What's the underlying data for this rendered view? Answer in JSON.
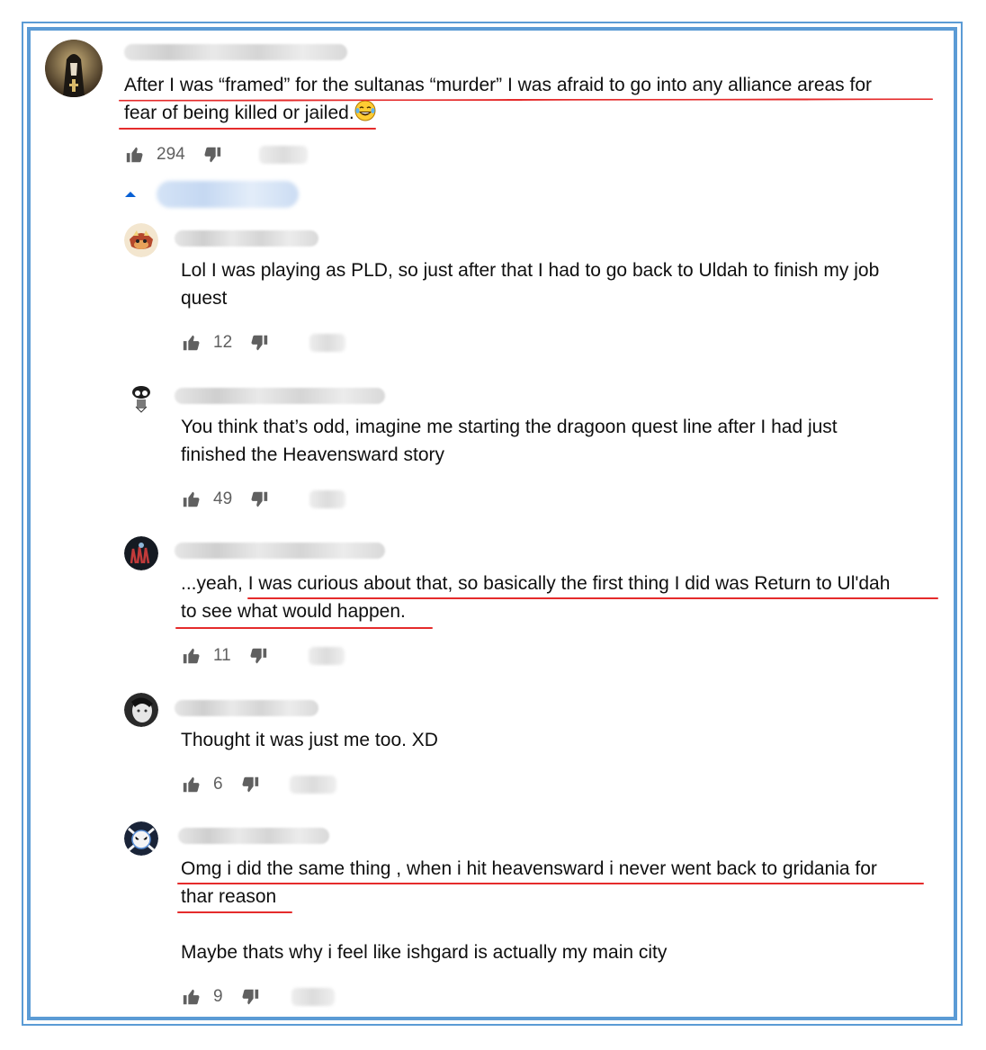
{
  "thread": {
    "top_comment": {
      "text_line1": "After I was “framed” for the sultanas “murder” I was afraid to go into any alliance areas for",
      "text_line2": "fear of being killed or jailed.",
      "emoji": "😂",
      "likes": "294"
    },
    "replies": [
      {
        "text_line1": "Lol I was playing as PLD, so just after that I had to go back to Uldah to finish my job",
        "text_line2": "quest",
        "likes": "12"
      },
      {
        "text_line1": "You think that’s odd, imagine me starting the dragoon quest line after I had just",
        "text_line2": "finished the Heavensward story",
        "likes": "49"
      },
      {
        "text_line1": "...yeah, I was curious about that, so basically the first thing I did was Return to Ul'dah",
        "text_line2": "to see what would happen.",
        "likes": "11"
      },
      {
        "text_line1": "Thought it was just me too. XD",
        "likes": "6"
      },
      {
        "text_line1": "Omg i did the same thing , when i hit heavensward i never went back to gridania for",
        "text_line2": "thar reason",
        "text_line3": "Maybe thats why i feel like ishgard is actually my main city",
        "likes": "9"
      }
    ]
  },
  "colors": {
    "frame": "#5b9bd5",
    "underline": "#e52b2b",
    "toggle": "#065fd4",
    "icon": "#606060"
  },
  "icons": [
    "thumbs-up-icon",
    "thumbs-down-icon",
    "caret-up-icon"
  ]
}
